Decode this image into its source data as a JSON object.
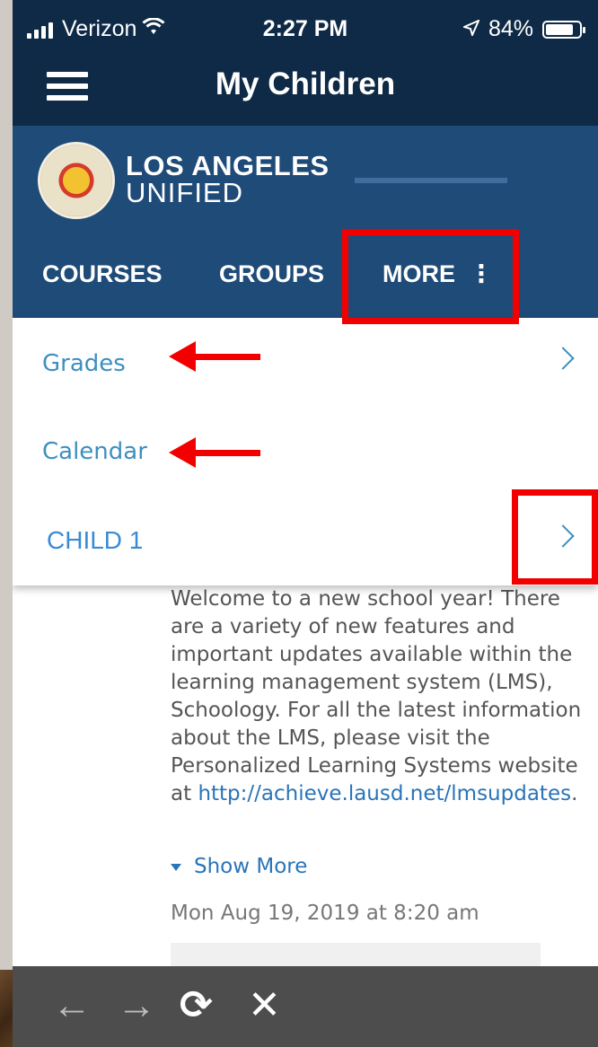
{
  "status": {
    "carrier": "Verizon",
    "time": "2:27 PM",
    "battery": "84%",
    "battery_level": 0.84
  },
  "navbar": {
    "title": "My Children"
  },
  "header": {
    "logo_line1": "LOS ANGELES",
    "logo_line2": "UNIFIED",
    "tabs": [
      {
        "label": "COURSES"
      },
      {
        "label": "GROUPS"
      },
      {
        "label": "MORE"
      }
    ],
    "more_icon": "⋮"
  },
  "dropdown": {
    "items": [
      {
        "label": "Grades"
      },
      {
        "label": "Calendar"
      },
      {
        "label": "CHILD 1"
      }
    ]
  },
  "content": {
    "body": "Welcome to a new school year! There are a variety of new features and important updates available within the learning management system (LMS), Schoology. For all the latest information about the LMS, please visit the Personalized Learning Systems website",
    "at": "at",
    "link": "http://achieve.lausd.net/lmsupdates",
    "period": ".",
    "show_more": "Show More",
    "date": "Mon Aug 19, 2019 at 8:20 am"
  },
  "browser": {
    "back_icon": "←",
    "forward_icon": "→",
    "reload_icon": "⟳",
    "close_icon": "✕"
  },
  "colors": {
    "nav": "#0f2a46",
    "header": "#1f4b78",
    "accent": "#3d8fc0",
    "annotation": "#f20000"
  }
}
